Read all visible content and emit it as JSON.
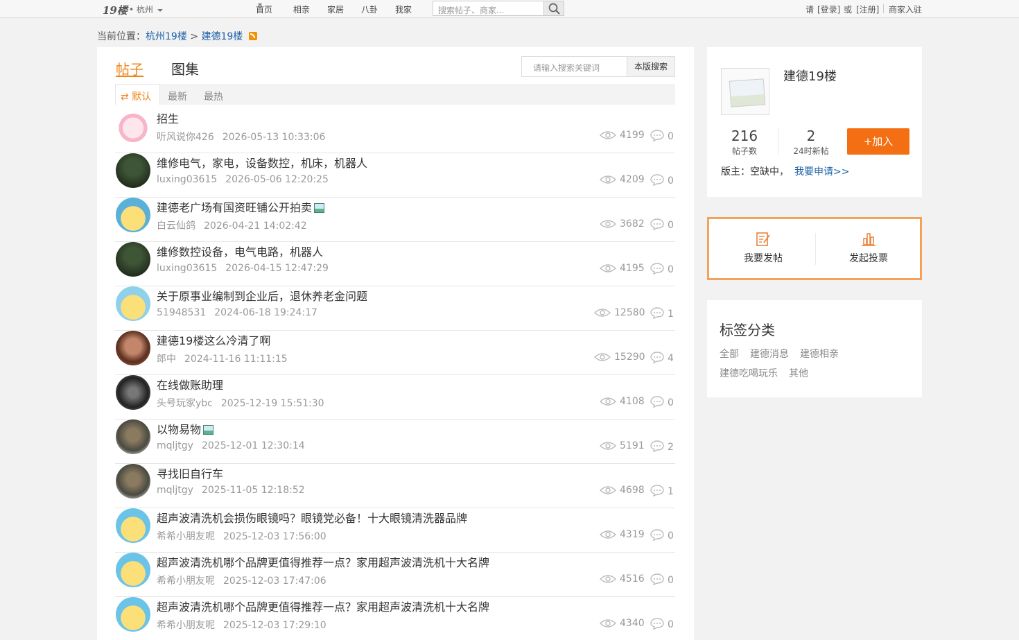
{
  "topbar": {
    "logo": "19楼",
    "city": "• 杭州",
    "nav": [
      "首页",
      "相亲",
      "家居",
      "八卦",
      "我家"
    ],
    "search_placeholder": "搜索帖子、商家...",
    "please": "请",
    "login": "[登录]",
    "or": "或",
    "register": "[注册]",
    "merchant": "商家入驻"
  },
  "breadcrumb": {
    "prefix": "当前位置：",
    "level1": "杭州19楼",
    "sep": ">",
    "level2": "建德19楼"
  },
  "main": {
    "tabs": [
      "帖子",
      "图集"
    ],
    "search_placeholder": "请输入搜索关键词",
    "search_button": "本版搜索",
    "sort_tabs": [
      "⇄ 默认",
      "最新",
      "最热"
    ]
  },
  "posts": [
    {
      "title": "招生",
      "author": "听风说你426",
      "date": "2026-05-13 10:33:06",
      "views": "4199",
      "replies": "0",
      "has_image": false
    },
    {
      "title": "维修电气，家电，设备数控，机床，机器人",
      "author": "luxing03615",
      "date": "2026-05-06 12:20:25",
      "views": "4209",
      "replies": "0",
      "has_image": false
    },
    {
      "title": "建德老广场有国资旺铺公开拍卖",
      "author": "白云仙鸽",
      "date": "2026-04-21 14:02:42",
      "views": "3682",
      "replies": "0",
      "has_image": true
    },
    {
      "title": "维修数控设备，电气电路，机器人",
      "author": "luxing03615",
      "date": "2026-04-15 12:47:29",
      "views": "4195",
      "replies": "0",
      "has_image": false
    },
    {
      "title": "关于原事业编制到企业后，退休养老金问题",
      "author": "51948531",
      "date": "2024-06-18 19:24:17",
      "views": "12580",
      "replies": "1",
      "has_image": false
    },
    {
      "title": "建德19楼这么冷清了啊",
      "author": "郎中",
      "date": "2024-11-16 11:11:15",
      "views": "15290",
      "replies": "4",
      "has_image": false
    },
    {
      "title": "在线做账助理",
      "author": "头号玩家ybc",
      "date": "2025-12-19 15:51:30",
      "views": "4108",
      "replies": "0",
      "has_image": false
    },
    {
      "title": "以物易物",
      "author": "mqljtgy",
      "date": "2025-12-01 12:30:14",
      "views": "5191",
      "replies": "2",
      "has_image": true
    },
    {
      "title": "寻找旧自行车",
      "author": "mqljtgy",
      "date": "2025-11-05 12:18:52",
      "views": "4698",
      "replies": "1",
      "has_image": false
    },
    {
      "title": "超声波清洗机会损伤眼镜吗？眼镜党必备！十大眼镜清洗器品牌",
      "author": "希希小朋友呢",
      "date": "2025-12-03 17:56:00",
      "views": "4319",
      "replies": "0",
      "has_image": false
    },
    {
      "title": "超声波清洗机哪个品牌更值得推荐一点？家用超声波清洗机十大名牌",
      "author": "希希小朋友呢",
      "date": "2025-12-03 17:47:06",
      "views": "4516",
      "replies": "0",
      "has_image": false
    },
    {
      "title": "超声波清洗机哪个品牌更值得推荐一点？家用超声波清洗机十大名牌",
      "author": "希希小朋友呢",
      "date": "2025-12-03 17:29:10",
      "views": "4340",
      "replies": "0",
      "has_image": false
    }
  ],
  "board": {
    "name": "建德19楼",
    "post_count": "216",
    "post_count_label": "帖子数",
    "new_24h": "2",
    "new_24h_label": "24时新帖",
    "join_button": "+加入",
    "moderator_text": "版主：空缺中，",
    "apply_link": "我要申请>>"
  },
  "actions": {
    "post": "我要发帖",
    "vote": "发起投票"
  },
  "tags": {
    "title": "标签分类",
    "items": [
      "全部",
      "建德消息",
      "建德相亲",
      "建德吃喝玩乐",
      "其他"
    ]
  },
  "colors": {
    "accent": "#f08519",
    "join": "#f46f13",
    "link": "#1a5fa6"
  }
}
